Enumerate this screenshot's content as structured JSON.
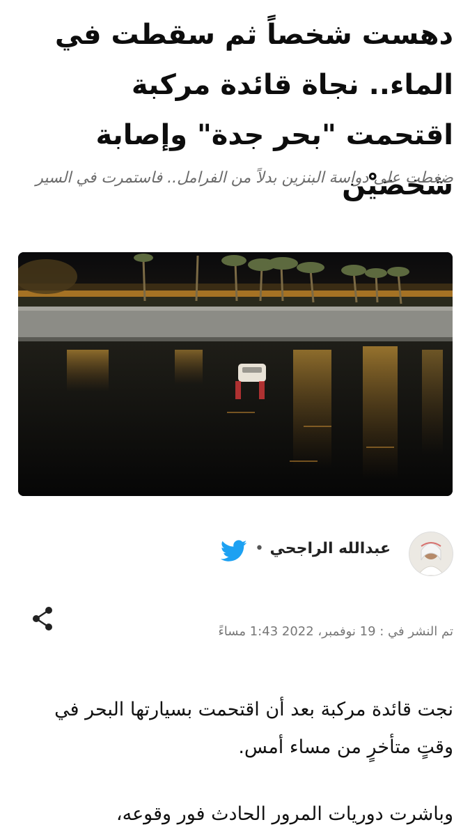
{
  "article": {
    "headline": "دهست شخصاً ثم سقطت في الماء.. نجاة قائدة مركبة اقتحمت \"بحر جدة\" وإصابة شخصَيْن",
    "subtitle": "ضغطت على دواسة البنزين بدلاً من الفرامل.. فاستمرت في السير",
    "author": {
      "name": "عبدالله الراجحي",
      "separator": "•"
    },
    "published": "تم النشر في : 19 نوفمبر، 2022 1:43 مساءً",
    "paragraph_1": "نجت قائدة مركبة بعد أن اقتحمت بسيارتها البحر في وقتٍ متأخرٍ من مساء أمس.",
    "paragraph_2": "وباشرت دوريات المرور الحادث فور وقوعه،"
  },
  "icons": {
    "twitter": "twitter-icon",
    "share": "share-icon"
  },
  "colors": {
    "twitter_blue": "#1da1f2",
    "subtitle_gray": "#6b6b6b",
    "meta_gray": "#777777"
  }
}
